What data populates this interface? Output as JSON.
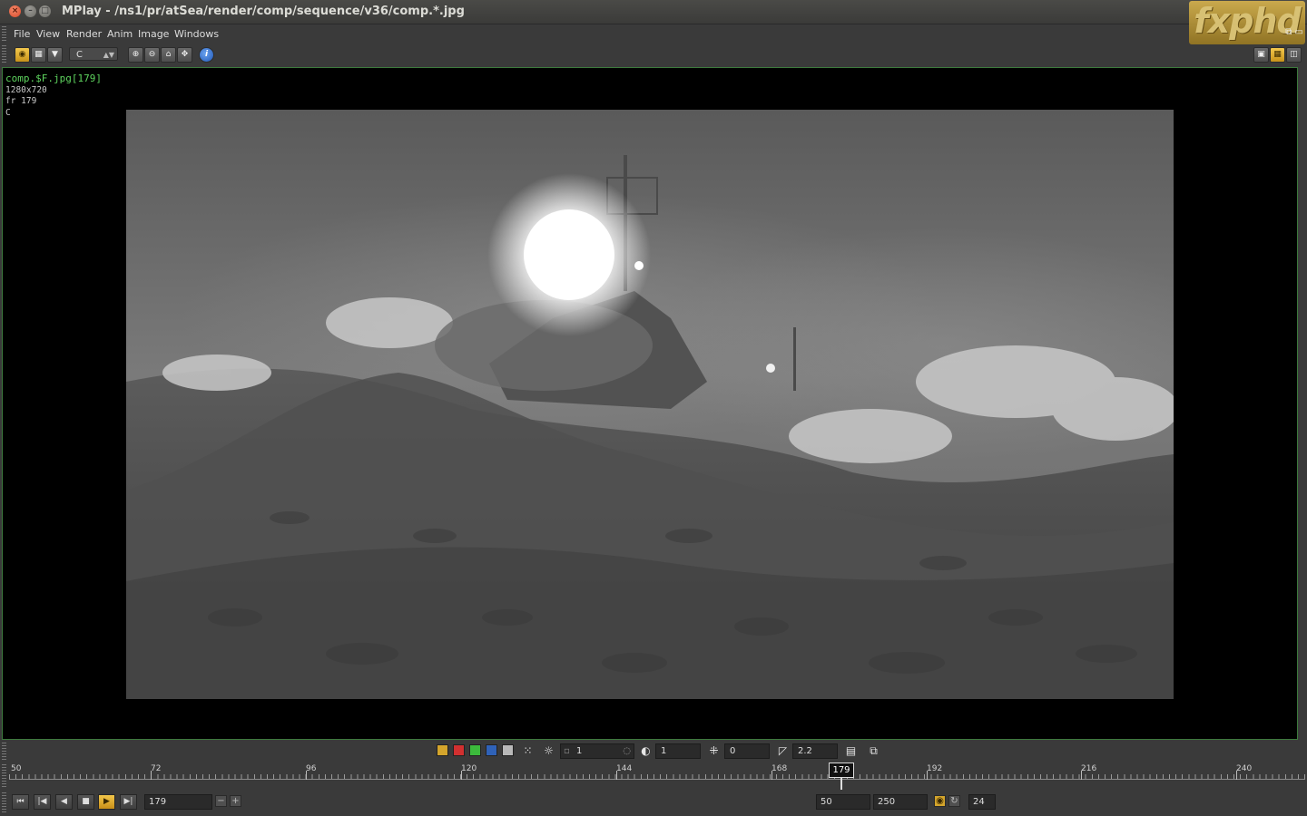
{
  "window": {
    "title": "MPlay - /ns1/pr/atSea/render/comp/sequence/v36/comp.*.jpg",
    "logo": "fxphd"
  },
  "menu": [
    "File",
    "View",
    "Render",
    "Anim",
    "Image",
    "Windows"
  ],
  "toolbar": {
    "channel": "C"
  },
  "viewer": {
    "overlay_filename": "comp.$F.jpg[179]",
    "overlay_resolution": "1280x720",
    "overlay_frame": "fr 179",
    "overlay_channel": "C"
  },
  "controls": {
    "gain_value": "1",
    "gamma_toggle_value": "1",
    "exposure_value": "0",
    "gamma_value": "2.2"
  },
  "timeline": {
    "labels": [
      "50",
      "72",
      "96",
      "120",
      "144",
      "168",
      "192",
      "216",
      "240"
    ],
    "current_frame": "179"
  },
  "transport": {
    "frame_field": "179",
    "range_start": "50",
    "range_end": "250",
    "fps": "24"
  }
}
